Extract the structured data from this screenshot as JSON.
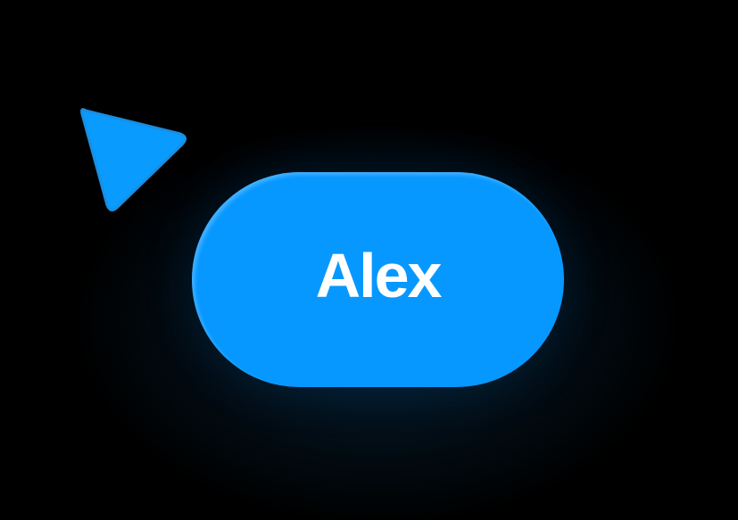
{
  "label": {
    "name": "Alex"
  },
  "colors": {
    "accent": "#0798ff",
    "background": "#000000"
  },
  "icons": {
    "cursor": "cursor-arrow-icon"
  }
}
